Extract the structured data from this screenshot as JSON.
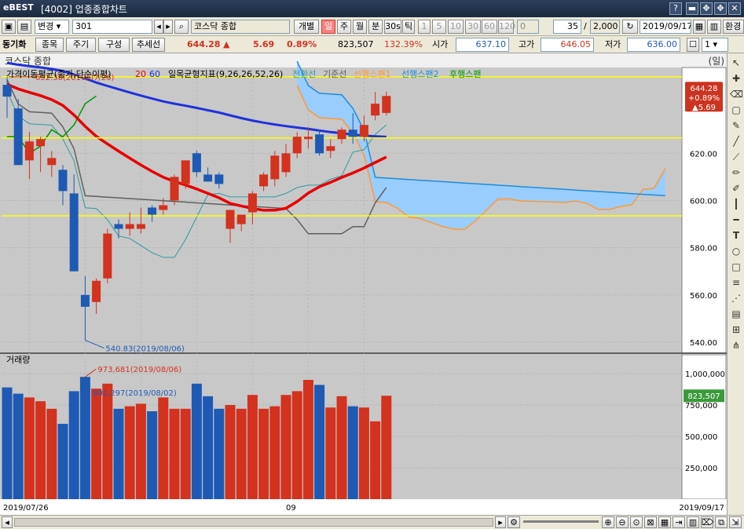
{
  "window": {
    "logo": "eBEST",
    "title": "[4002] 업종종합차트",
    "buttons": [
      "?",
      "▬",
      "✥",
      "✥",
      "✕"
    ]
  },
  "toolbar1": {
    "mode_dropdown": "변경",
    "code_value": "301",
    "index_name": "코스닥 종합",
    "individual_label": "개별",
    "periods": [
      "일",
      "주",
      "월",
      "분",
      "30s",
      "틱"
    ],
    "active_period": "일",
    "intervals": [
      "1",
      "5",
      "10",
      "30",
      "60",
      "120"
    ],
    "zero_value": "0",
    "count_value": "35",
    "count_total": "2,000",
    "date_value": "2019/09/17",
    "env_label": "환경"
  },
  "toolbar2": {
    "tabs": [
      "동기화",
      "종목",
      "주기",
      "구성",
      "추세선"
    ],
    "price": "644.28",
    "change_arrow": "▲",
    "change": "5.69",
    "change_pct": "0.89%",
    "volume": "823,507",
    "volume_pct": "132.39%",
    "open_label": "시가",
    "open": "637.10",
    "high_label": "고가",
    "high": "646.05",
    "low_label": "저가",
    "low": "636.00",
    "spin_value": "1"
  },
  "chart_header": {
    "name": "코스닥 종합",
    "unit": "(일)"
  },
  "price_panel": {
    "legend_ma": "가격이동평균(종가,단순이평)",
    "ma_periods": [
      "20",
      "60"
    ],
    "legend_ichimoku": "일목균형지표(9,26,26,52,26)",
    "ichimoku_lines": [
      "전환선",
      "기준선",
      "선행스팬1",
      "선행스팬2",
      "후행스팬"
    ],
    "annotation_high": "652.38(2019/07/26)",
    "annotation_low": "540.83(2019/08/06)",
    "current_badge": [
      "644.28",
      "+0.89%",
      "▲5.69"
    ],
    "y_ticks": [
      "620.00",
      "600.00",
      "580.00",
      "560.00",
      "540.00"
    ]
  },
  "volume_panel": {
    "title": "거래량",
    "annotation_max": "973,681(2019/08/06)",
    "annotation_other": "801,297(2019/08/02)",
    "current_badge": "823,507",
    "y_ticks": [
      "1,000,000",
      "750,000",
      "500,000",
      "250,000"
    ]
  },
  "x_axis": {
    "start_date": "2019/07/26",
    "mid_label": "09",
    "end_date": "2019/09/17"
  },
  "colors": {
    "up": "#d2321e",
    "down": "#1e5ab4",
    "ma20": "#e60000",
    "ma60": "#1e32dc",
    "cloud": "#99ccff",
    "tenkan": "#2e9aa0",
    "kijun": "#606060",
    "span1": "#ff9933",
    "span2": "#1e8cdc",
    "chikou": "#009600",
    "hline": "#ffff00",
    "panel_bg": "#c8c8c8"
  },
  "chart_data": [
    {
      "type": "candlestick",
      "title": "코스닥 종합",
      "x": [
        "2019/07/26",
        "2019/07/29",
        "2019/07/30",
        "2019/07/31",
        "2019/08/01",
        "2019/08/02",
        "2019/08/05",
        "2019/08/06",
        "2019/08/07",
        "2019/08/08",
        "2019/08/09",
        "2019/08/12",
        "2019/08/13",
        "2019/08/14",
        "2019/08/16",
        "2019/08/19",
        "2019/08/20",
        "2019/08/21",
        "2019/08/22",
        "2019/08/23",
        "2019/08/26",
        "2019/08/27",
        "2019/08/28",
        "2019/08/29",
        "2019/08/30",
        "2019/09/02",
        "2019/09/03",
        "2019/09/04",
        "2019/09/05",
        "2019/09/06",
        "2019/09/09",
        "2019/09/10",
        "2019/09/11",
        "2019/09/16",
        "2019/09/17"
      ],
      "open": [
        649.0,
        639.0,
        617.0,
        623.0,
        615.0,
        613.0,
        603.0,
        560.0,
        557.0,
        567.0,
        590.0,
        588.0,
        588.0,
        597.0,
        596.0,
        600.0,
        607.0,
        620.0,
        611.0,
        611.0,
        588.0,
        590.0,
        595.0,
        606.0,
        609.0,
        612.0,
        620.0,
        626.0,
        628.0,
        621.0,
        626.0,
        630.0,
        627.0,
        636.0,
        637.1
      ],
      "high": [
        652.38,
        643.0,
        629.0,
        627.0,
        621.0,
        615.0,
        611.0,
        568.0,
        567.0,
        588.0,
        592.0,
        595.0,
        597.0,
        598.0,
        601.0,
        611.0,
        615.0,
        621.0,
        614.0,
        612.0,
        590.0,
        594.0,
        604.0,
        612.0,
        621.0,
        624.0,
        629.0,
        631.0,
        630.0,
        626.0,
        631.0,
        637.0,
        636.0,
        646.0,
        646.05
      ],
      "low": [
        635.0,
        615.0,
        609.0,
        612.0,
        610.0,
        598.0,
        580.0,
        540.83,
        552.0,
        565.0,
        584.0,
        585.0,
        586.0,
        591.0,
        594.0,
        598.0,
        605.0,
        610.0,
        608.0,
        605.0,
        582.0,
        587.0,
        590.0,
        604.0,
        606.0,
        610.0,
        618.0,
        622.0,
        619.0,
        618.0,
        624.0,
        624.0,
        625.0,
        634.0,
        636.0
      ],
      "close": [
        644.0,
        615.0,
        625.0,
        626.0,
        618.0,
        604.0,
        570.0,
        555.0,
        566.0,
        586.0,
        588.0,
        590.0,
        590.0,
        594.0,
        598.0,
        610.0,
        617.0,
        612.0,
        608.0,
        607.0,
        596.0,
        594.0,
        603.0,
        611.0,
        619.0,
        620.0,
        627.0,
        627.0,
        620.0,
        623.0,
        630.0,
        627.0,
        632.0,
        641.0,
        644.28
      ]
    },
    {
      "type": "bar",
      "title": "거래량",
      "x_ref": "same as candlestick",
      "values": [
        890000,
        840000,
        810000,
        780000,
        720000,
        600000,
        860000,
        973681,
        880000,
        920000,
        720000,
        740000,
        760000,
        700000,
        810000,
        720000,
        720000,
        920000,
        820000,
        720000,
        750000,
        720000,
        830000,
        720000,
        740000,
        830000,
        860000,
        950000,
        910000,
        730000,
        820000,
        740000,
        730000,
        620000,
        823507
      ],
      "ylim": [
        0,
        1000000
      ]
    }
  ]
}
